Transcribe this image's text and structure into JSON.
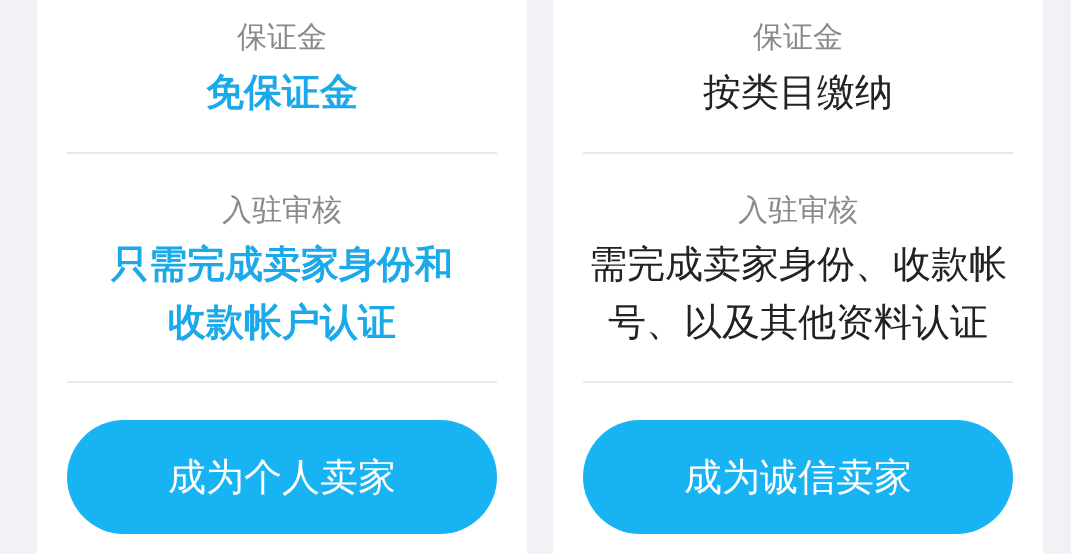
{
  "cards": [
    {
      "highlight": true,
      "deposit_label": "保证金",
      "deposit_value": [
        "免保证金"
      ],
      "review_label": "入驻审核",
      "review_value": [
        "只需完成卖家身份和",
        "收款帐户认证"
      ],
      "button": "成为个人卖家"
    },
    {
      "highlight": false,
      "deposit_label": "保证金",
      "deposit_value": [
        "按类目缴纳"
      ],
      "review_label": "入驻审核",
      "review_value": [
        "需完成卖家身份、收款帐",
        "号、以及其他资料认证"
      ],
      "button": "成为诚信卖家"
    }
  ]
}
